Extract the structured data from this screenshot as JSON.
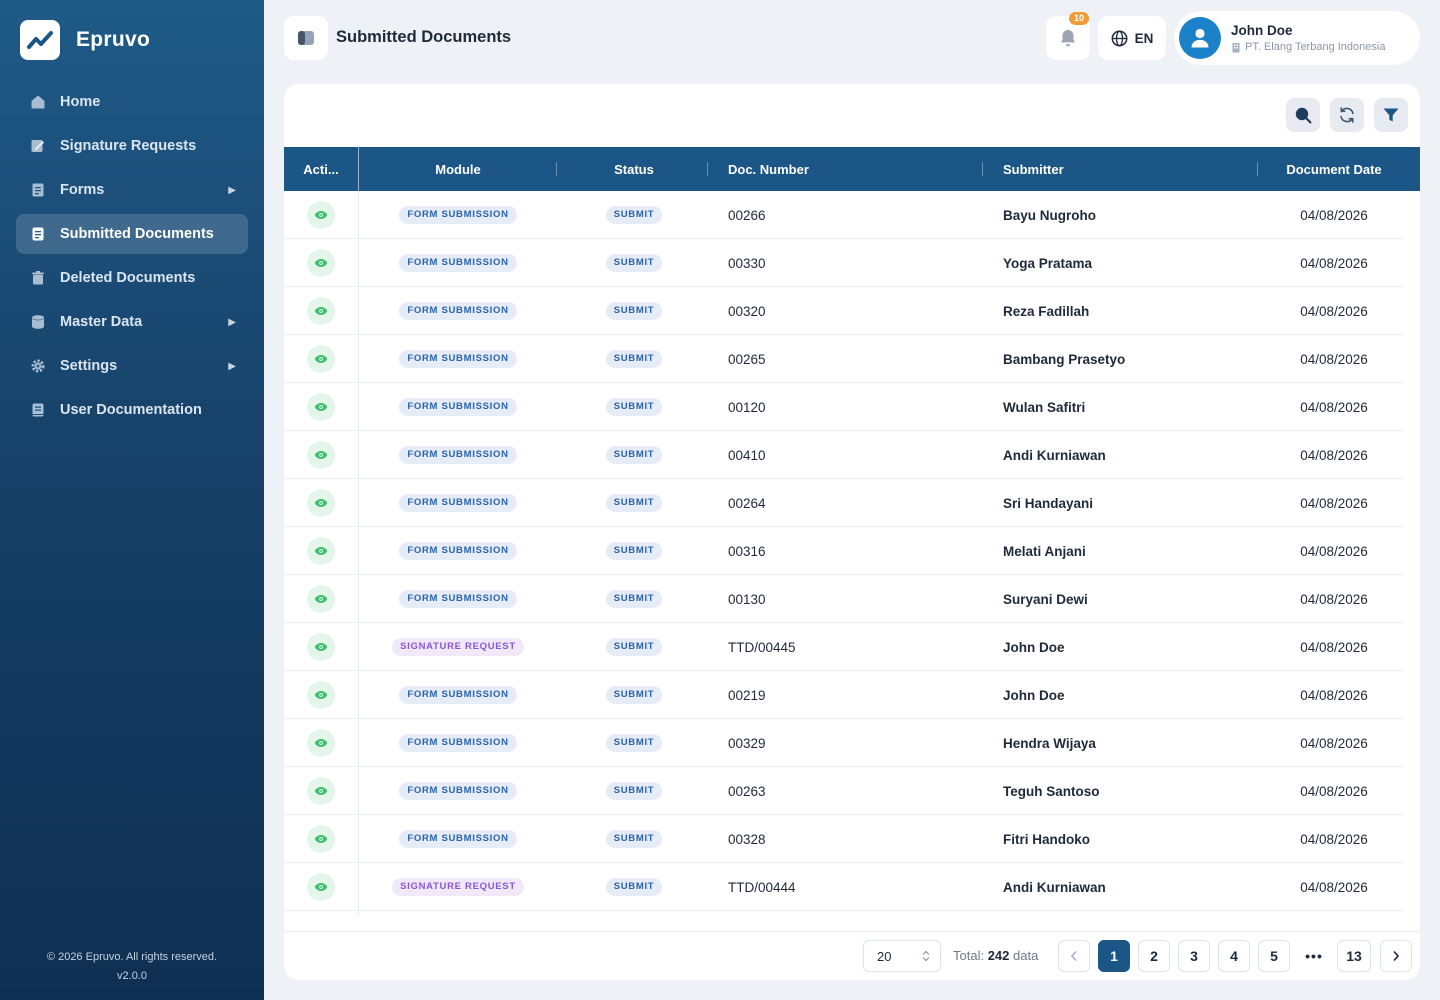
{
  "app": {
    "name": "Epruvo"
  },
  "sidebar": {
    "items": [
      {
        "label": "Home",
        "icon": "home-icon",
        "has_submenu": false,
        "active": false
      },
      {
        "label": "Signature Requests",
        "icon": "signature-icon",
        "has_submenu": false,
        "active": false
      },
      {
        "label": "Forms",
        "icon": "form-icon",
        "has_submenu": true,
        "active": false
      },
      {
        "label": "Submitted Documents",
        "icon": "document-icon",
        "has_submenu": false,
        "active": true
      },
      {
        "label": "Deleted Documents",
        "icon": "trash-icon",
        "has_submenu": false,
        "active": false
      },
      {
        "label": "Master Data",
        "icon": "database-icon",
        "has_submenu": true,
        "active": false
      },
      {
        "label": "Settings",
        "icon": "gear-icon",
        "has_submenu": true,
        "active": false
      },
      {
        "label": "User Documentation",
        "icon": "book-icon",
        "has_submenu": false,
        "active": false
      }
    ],
    "footer_copyright": "© 2026 Epruvo. All rights reserved.",
    "footer_version": "v2.0.0"
  },
  "header": {
    "title": "Submitted Documents",
    "notification_count": "10",
    "language": "EN",
    "user_name": "John Doe",
    "user_org": "PT. Elang Terbang Indonesia"
  },
  "table": {
    "columns": [
      "Acti...",
      "Module",
      "Status",
      "Doc. Number",
      "Submitter",
      "Document Date"
    ],
    "rows": [
      {
        "module": "FORM SUBMISSION",
        "module_type": "form",
        "status": "SUBMIT",
        "doc_number": "00266",
        "submitter": "Bayu Nugroho",
        "date": "04/08/2026"
      },
      {
        "module": "FORM SUBMISSION",
        "module_type": "form",
        "status": "SUBMIT",
        "doc_number": "00330",
        "submitter": "Yoga Pratama",
        "date": "04/08/2026"
      },
      {
        "module": "FORM SUBMISSION",
        "module_type": "form",
        "status": "SUBMIT",
        "doc_number": "00320",
        "submitter": "Reza Fadillah",
        "date": "04/08/2026"
      },
      {
        "module": "FORM SUBMISSION",
        "module_type": "form",
        "status": "SUBMIT",
        "doc_number": "00265",
        "submitter": "Bambang Prasetyo",
        "date": "04/08/2026"
      },
      {
        "module": "FORM SUBMISSION",
        "module_type": "form",
        "status": "SUBMIT",
        "doc_number": "00120",
        "submitter": "Wulan Safitri",
        "date": "04/08/2026"
      },
      {
        "module": "FORM SUBMISSION",
        "module_type": "form",
        "status": "SUBMIT",
        "doc_number": "00410",
        "submitter": "Andi Kurniawan",
        "date": "04/08/2026"
      },
      {
        "module": "FORM SUBMISSION",
        "module_type": "form",
        "status": "SUBMIT",
        "doc_number": "00264",
        "submitter": "Sri Handayani",
        "date": "04/08/2026"
      },
      {
        "module": "FORM SUBMISSION",
        "module_type": "form",
        "status": "SUBMIT",
        "doc_number": "00316",
        "submitter": "Melati Anjani",
        "date": "04/08/2026"
      },
      {
        "module": "FORM SUBMISSION",
        "module_type": "form",
        "status": "SUBMIT",
        "doc_number": "00130",
        "submitter": "Suryani Dewi",
        "date": "04/08/2026"
      },
      {
        "module": "SIGNATURE REQUEST",
        "module_type": "sign",
        "status": "SUBMIT",
        "doc_number": "TTD/00445",
        "submitter": "John Doe",
        "date": "04/08/2026"
      },
      {
        "module": "FORM SUBMISSION",
        "module_type": "form",
        "status": "SUBMIT",
        "doc_number": "00219",
        "submitter": "John Doe",
        "date": "04/08/2026"
      },
      {
        "module": "FORM SUBMISSION",
        "module_type": "form",
        "status": "SUBMIT",
        "doc_number": "00329",
        "submitter": "Hendra Wijaya",
        "date": "04/08/2026"
      },
      {
        "module": "FORM SUBMISSION",
        "module_type": "form",
        "status": "SUBMIT",
        "doc_number": "00263",
        "submitter": "Teguh Santoso",
        "date": "04/08/2026"
      },
      {
        "module": "FORM SUBMISSION",
        "module_type": "form",
        "status": "SUBMIT",
        "doc_number": "00328",
        "submitter": "Fitri Handoko",
        "date": "04/08/2026"
      },
      {
        "module": "SIGNATURE REQUEST",
        "module_type": "sign",
        "status": "SUBMIT",
        "doc_number": "TTD/00444",
        "submitter": "Andi Kurniawan",
        "date": "04/08/2026"
      }
    ]
  },
  "pagination": {
    "page_size": "20",
    "total_prefix": "Total:",
    "total_count": "242",
    "total_suffix": "data",
    "pages": [
      "1",
      "2",
      "3",
      "4",
      "5"
    ],
    "ellipsis": "•••",
    "last_page": "13",
    "current_page": "1"
  },
  "colors": {
    "sidebar_top": "#1f5a87",
    "sidebar_bottom": "#0f2f52",
    "table_header": "#1b5687",
    "accent_orange": "#f29c38",
    "view_icon": "#3fbf6e"
  }
}
